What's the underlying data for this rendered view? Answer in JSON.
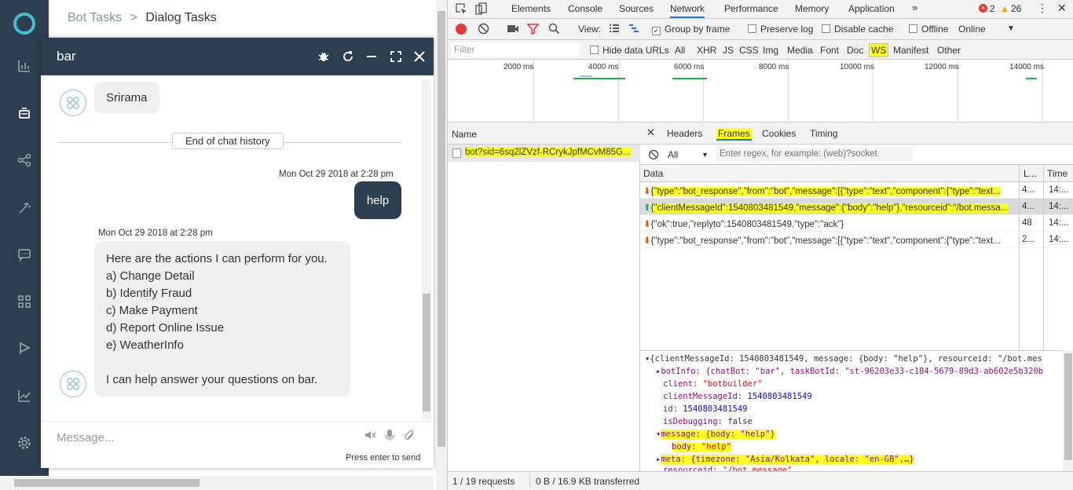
{
  "app": {
    "breadcrumb": {
      "parent": "Bot Tasks",
      "sep": ">",
      "current": "Dialog Tasks"
    }
  },
  "chat": {
    "title": "bar",
    "messages": {
      "first_reply": "Srirama",
      "history_divider": "End of chat history",
      "user_time": "Mon Oct 29 2018 at 2:28 pm",
      "user_msg": "help",
      "bot_time": "Mon Oct 29 2018 at 2:28 pm",
      "bot_intro": "Here are the actions I can perform for you.",
      "actions": [
        "a) Change Detail",
        "b) Identify Fraud",
        "c) Make Payment",
        "d) Report Online Issue",
        "e) WeatherInfo"
      ],
      "bot_outro": "I can help answer your questions on bar."
    },
    "input_placeholder": "Message...",
    "press_enter": "Press enter to send"
  },
  "devtools": {
    "tabs": [
      "Elements",
      "Console",
      "Sources",
      "Network",
      "Performance",
      "Memory",
      "Application"
    ],
    "active_tab": "Network",
    "errors": "2",
    "warnings": "26",
    "toolbar": {
      "view": "View:",
      "group_by_frame": "Group by frame",
      "preserve_log": "Preserve log",
      "disable_cache": "Disable cache",
      "offline": "Offline",
      "throttle": "Online"
    },
    "filter": {
      "placeholder": "Filter",
      "hide_data_urls": "Hide data URLs",
      "types": [
        "All",
        "XHR",
        "JS",
        "CSS",
        "Img",
        "Media",
        "Font",
        "Doc",
        "WS",
        "Manifest",
        "Other"
      ]
    },
    "timeline": [
      "2000 ms",
      "4000 ms",
      "6000 ms",
      "8000 ms",
      "10000 ms",
      "12000 ms",
      "14000 ms"
    ],
    "requests": {
      "header": "Name",
      "items": [
        "bot?sid=6sq2lZVzf-RCrykJpfMCvM85G..."
      ]
    },
    "detail_tabs": [
      "Headers",
      "Frames",
      "Cookies",
      "Timing"
    ],
    "frames_filter": {
      "select": "All",
      "placeholder": "Enter regex, for example: (web)?socket"
    },
    "frames_cols": {
      "data": "Data",
      "length": "L...",
      "time": "Time"
    },
    "frames": [
      {
        "data": "{\"type\":\"bot_response\",\"from\":\"bot\",\"message\":[{\"type\":\"text\",\"component\":{\"type\":\"text...",
        "length": "4...",
        "time": "14:..."
      },
      {
        "data": "{\"clientMessageId\":1540803481549,\"message\":{\"body\":\"help\"},\"resourceid\":\"/bot.messa...",
        "length": "4...",
        "time": "14:..."
      },
      {
        "data": "{\"ok\":true,\"replyto\":1540803481549,\"type\":\"ack\"}",
        "length": "48",
        "time": "14:..."
      },
      {
        "data": "{\"type\":\"bot_response\",\"from\":\"bot\",\"message\":[{\"type\":\"text\",\"component\":{\"type\":\"text...",
        "length": "2...",
        "time": "14:..."
      }
    ],
    "tree": {
      "root": "{clientMessageId: 1540803481549, message: {body: \"help\"}, resourceid: \"/bot.mes",
      "botInfo": "botInfo: {chatBot: \"bar\", taskBotId: \"st-96203e33-c184-5679-89d3-ab602e5b320b",
      "client_k": "client:",
      "client_v": "\"botbuilder\"",
      "cmid_k": "clientMessageId:",
      "cmid_v": "1540803481549",
      "id_k": "id:",
      "id_v": "1540803481549",
      "dbg_k": "isDebugging:",
      "dbg_v": "false",
      "msg": "message: {body: \"help\"}",
      "body_k": "body:",
      "body_v": "\"help\"",
      "meta": "meta: {timezone: \"Asia/Kolkata\", locale: \"en-GB\",…}",
      "res_k": "resourceid:",
      "res_v": "\"/bot.message\""
    },
    "status": "1 / 19 requests",
    "transfer": "0 B / 16.9 KB transferred"
  },
  "colors": {
    "nav": "#2d3e50",
    "highlight": "#ffff26",
    "accent": "#1a73e8"
  }
}
